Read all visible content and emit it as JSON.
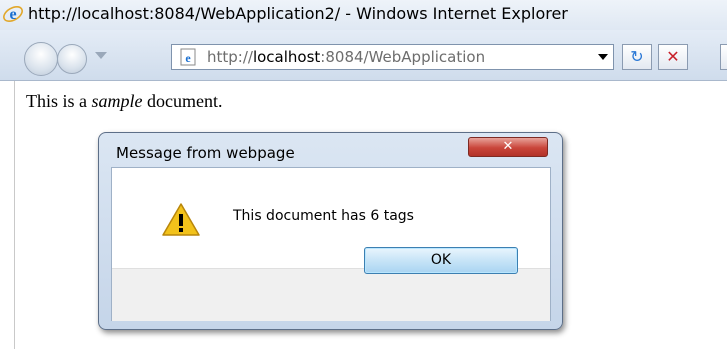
{
  "window": {
    "title": "http://localhost:8084/WebApplication2/ - Windows Internet Explorer"
  },
  "toolbar": {
    "address_prefix": "http://",
    "address_host": "localhost",
    "address_rest": ":8084/WebApplication",
    "refresh_glyph": "↻",
    "stop_glyph": "✕"
  },
  "document": {
    "text_before": "This is a ",
    "text_emphasis": "sample",
    "text_after": " document."
  },
  "dialog": {
    "title": "Message from webpage",
    "close_glyph": "✕",
    "message": "This document has 6 tags",
    "ok_label": "OK"
  },
  "icons": {
    "browser": "ie-logo-icon",
    "page": "page-icon",
    "warning": "warning-icon"
  },
  "colors": {
    "close_button": "#c9453a",
    "ok_button": "#a9d4f2",
    "warning": "#f2c21b"
  }
}
